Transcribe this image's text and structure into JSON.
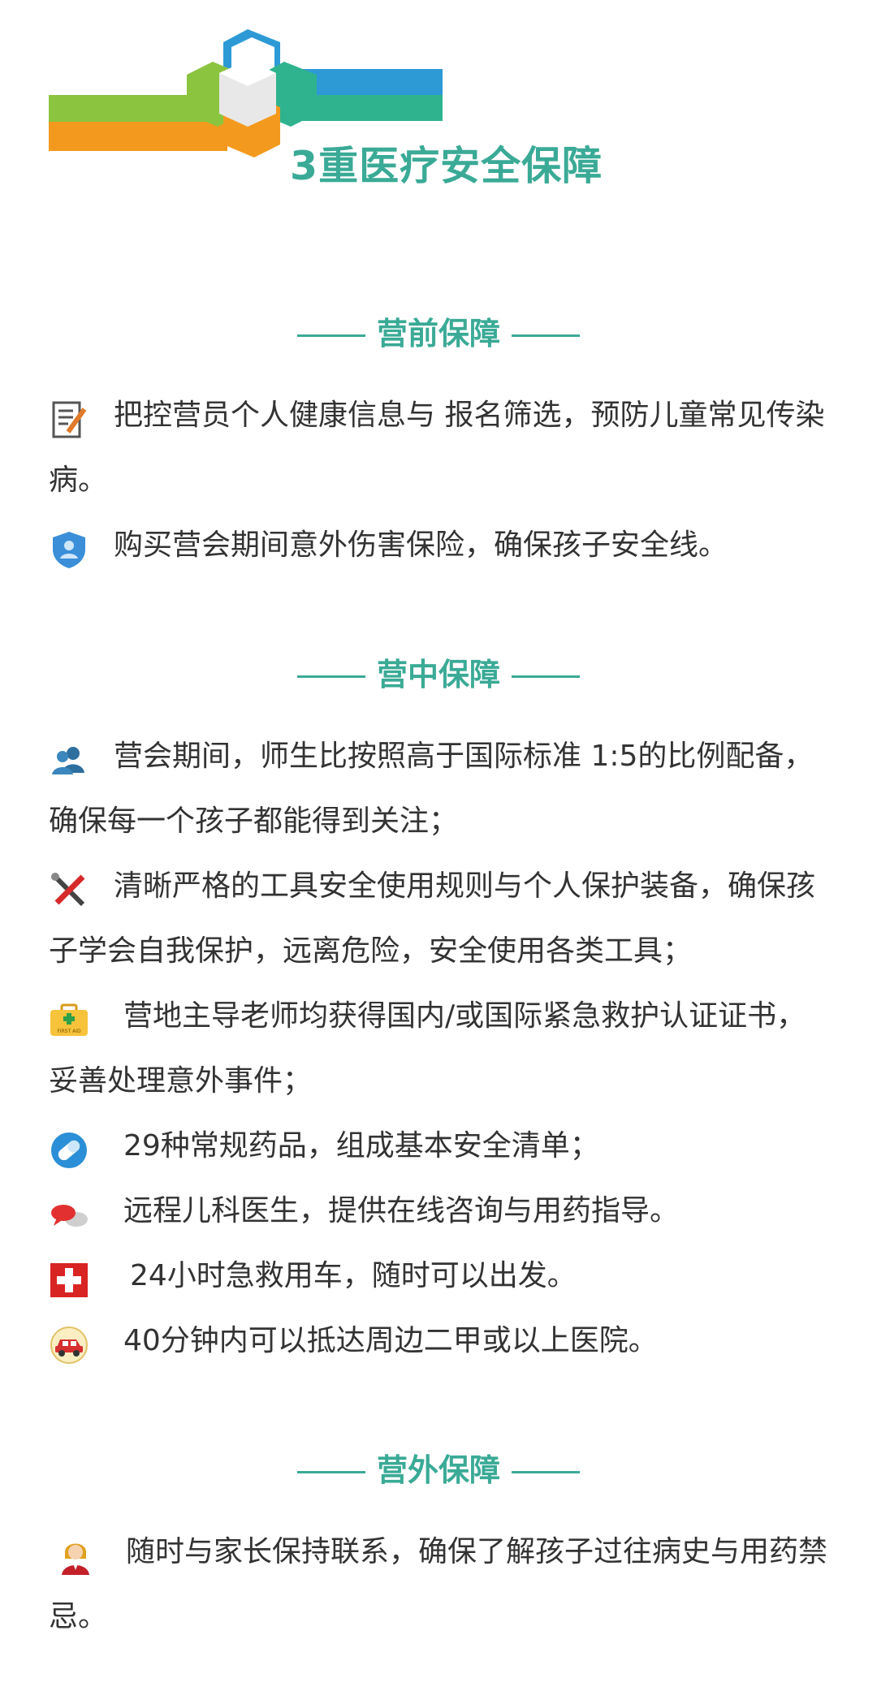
{
  "header": {
    "title": "3重医疗安全保障"
  },
  "sections": [
    {
      "heading": "营前保障",
      "items": [
        {
          "icon": "memo-pencil-icon",
          "text": "把控营员个人健康信息与 报名筛选，预防儿童常见传染病。"
        },
        {
          "icon": "shield-person-icon",
          "text": "购买营会期间意外伤害保险，确保孩子安全线。"
        }
      ]
    },
    {
      "heading": "营中保障",
      "items": [
        {
          "icon": "people-icon",
          "text": "营会期间，师生比按照高于国际标准 1:5的比例配备，确保每一个孩子都能得到关注；"
        },
        {
          "icon": "tools-icon",
          "text": "清晰严格的工具安全使用规则与个人保护装备，确保孩子学会自我保护，远离危险，安全使用各类工具；"
        },
        {
          "icon": "first-aid-kit-icon",
          "text": "营地主导老师均获得国内/或国际紧急救护认证证书，妥善处理意外事件；"
        },
        {
          "icon": "pill-icon",
          "text": "29种常规药品，组成基本安全清单；"
        },
        {
          "icon": "chat-bubbles-icon",
          "text": "远程儿科医生，提供在线咨询与用药指导。"
        },
        {
          "icon": "red-cross-icon",
          "text": "24小时急救用车，随时可以出发。"
        },
        {
          "icon": "car-icon",
          "text": "40分钟内可以抵达周边二甲或以上医院。"
        }
      ]
    },
    {
      "heading": "营外保障",
      "items": [
        {
          "icon": "contact-person-icon",
          "text": "随时与家长保持联系，确保了解孩子过往病史与用药禁忌。"
        }
      ]
    }
  ],
  "kit_label": "FIRST AID",
  "colors": {
    "accent": "#3aaa96",
    "blue": "#2d9ad6",
    "green": "#8bc43f",
    "orange": "#f39a1e",
    "teal": "#2fb38f",
    "red": "#e12a2a"
  }
}
